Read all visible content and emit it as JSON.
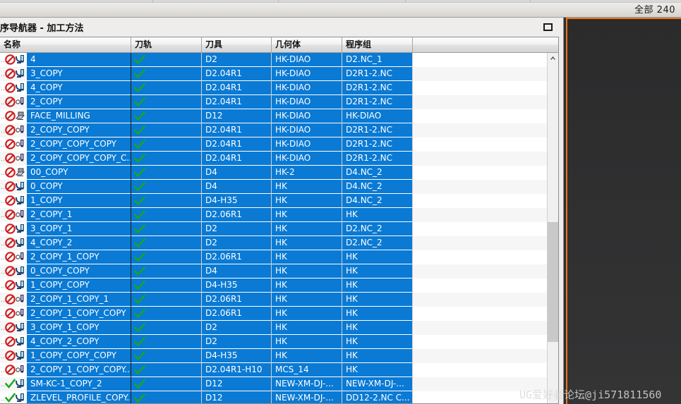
{
  "topbar": {
    "all_count_label": "全部 240"
  },
  "panel": {
    "title": "序导航器 - 加工方法",
    "restore_button_label": ""
  },
  "table": {
    "columns": [
      {
        "key": "name",
        "label": "名称"
      },
      {
        "key": "toolpath",
        "label": "刀轨"
      },
      {
        "key": "tool",
        "label": "刀具"
      },
      {
        "key": "geometry",
        "label": "几何体"
      },
      {
        "key": "program",
        "label": "程序组"
      },
      {
        "key": "extra",
        "label": ""
      }
    ],
    "rows": [
      {
        "status": "blocked",
        "type": "contour",
        "name": "4",
        "toolpath": "ok",
        "tool": "D2",
        "geometry": "HK-DIAO",
        "program": "D2.NC_1"
      },
      {
        "status": "blocked",
        "type": "contour",
        "name": "3_COPY",
        "toolpath": "ok",
        "tool": "D2.04R1",
        "geometry": "HK-DIAO",
        "program": "D2R1-2.NC"
      },
      {
        "status": "blocked",
        "type": "contour",
        "name": "4_COPY",
        "toolpath": "ok",
        "tool": "D2.04R1",
        "geometry": "HK-DIAO",
        "program": "D2R1-2.NC"
      },
      {
        "status": "blocked",
        "type": "drill",
        "name": "2_COPY",
        "toolpath": "ok",
        "tool": "D2.04R1",
        "geometry": "HK-DIAO",
        "program": "D2R1-2.NC"
      },
      {
        "status": "blocked",
        "type": "face",
        "name": "FACE_MILLING",
        "toolpath": "ok",
        "tool": "D12",
        "geometry": "HK-DIAO",
        "program": "HK-DIAO"
      },
      {
        "status": "blocked",
        "type": "drill",
        "name": "2_COPY_COPY",
        "toolpath": "ok",
        "tool": "D2.04R1",
        "geometry": "HK-DIAO",
        "program": "D2R1-2.NC"
      },
      {
        "status": "blocked",
        "type": "drill",
        "name": "2_COPY_COPY_COPY",
        "toolpath": "ok",
        "tool": "D2.04R1",
        "geometry": "HK-DIAO",
        "program": "D2R1-2.NC"
      },
      {
        "status": "blocked",
        "type": "drill",
        "name": "2_COPY_COPY_COPY_C...",
        "toolpath": "ok",
        "tool": "D2.04R1",
        "geometry": "HK-DIAO",
        "program": "D2R1-2.NC"
      },
      {
        "status": "blocked",
        "type": "face",
        "name": "00_COPY",
        "toolpath": "ok",
        "tool": "D4",
        "geometry": "HK-2",
        "program": "D4.NC_2"
      },
      {
        "status": "blocked",
        "type": "contour",
        "name": "0_COPY",
        "toolpath": "ok",
        "tool": "D4",
        "geometry": "HK",
        "program": "D4.NC_2"
      },
      {
        "status": "blocked",
        "type": "contour",
        "name": "1_COPY",
        "toolpath": "ok",
        "tool": "D4-H35",
        "geometry": "HK",
        "program": "D4.NC_2"
      },
      {
        "status": "blocked",
        "type": "drill",
        "name": "2_COPY_1",
        "toolpath": "ok",
        "tool": "D2.06R1",
        "geometry": "HK",
        "program": "HK"
      },
      {
        "status": "blocked",
        "type": "contour",
        "name": "3_COPY_1",
        "toolpath": "ok",
        "tool": "D2",
        "geometry": "HK",
        "program": "D2.NC_2"
      },
      {
        "status": "blocked",
        "type": "contour",
        "name": "4_COPY_2",
        "toolpath": "ok",
        "tool": "D2",
        "geometry": "HK",
        "program": "D2.NC_2"
      },
      {
        "status": "blocked",
        "type": "drill",
        "name": "2_COPY_1_COPY",
        "toolpath": "ok",
        "tool": "D2.06R1",
        "geometry": "HK",
        "program": "HK"
      },
      {
        "status": "blocked",
        "type": "contour",
        "name": "0_COPY_COPY",
        "toolpath": "ok",
        "tool": "D4",
        "geometry": "HK",
        "program": "HK"
      },
      {
        "status": "blocked",
        "type": "contour",
        "name": "1_COPY_COPY",
        "toolpath": "ok",
        "tool": "D4-H35",
        "geometry": "HK",
        "program": "HK"
      },
      {
        "status": "blocked",
        "type": "drill",
        "name": "2_COPY_1_COPY_1",
        "toolpath": "ok",
        "tool": "D2.06R1",
        "geometry": "HK",
        "program": "HK"
      },
      {
        "status": "blocked",
        "type": "drill",
        "name": "2_COPY_1_COPY_COPY",
        "toolpath": "ok",
        "tool": "D2.06R1",
        "geometry": "HK",
        "program": "HK"
      },
      {
        "status": "blocked",
        "type": "contour",
        "name": "3_COPY_1_COPY",
        "toolpath": "ok",
        "tool": "D2",
        "geometry": "HK",
        "program": "HK"
      },
      {
        "status": "blocked",
        "type": "contour",
        "name": "4_COPY_2_COPY",
        "toolpath": "ok",
        "tool": "D2",
        "geometry": "HK",
        "program": "HK"
      },
      {
        "status": "blocked",
        "type": "contour",
        "name": "1_COPY_COPY_COPY",
        "toolpath": "ok",
        "tool": "D4-H35",
        "geometry": "HK",
        "program": "HK"
      },
      {
        "status": "blocked",
        "type": "drill",
        "name": "2_COPY_1_COPY_COPY...",
        "toolpath": "ok",
        "tool": "D2.04R1-H10",
        "geometry": "MCS_14",
        "program": "HK"
      },
      {
        "status": "done",
        "type": "contour",
        "name": "SM-KC-1_COPY_2",
        "toolpath": "ok",
        "tool": "D12",
        "geometry": "NEW-XM-DJ-...",
        "program": "NEW-XM-DJ-..."
      },
      {
        "status": "done",
        "type": "contour",
        "name": "ZLEVEL_PROFILE_COPY...",
        "toolpath": "ok",
        "tool": "D12",
        "geometry": "NEW-XM-DJ-...",
        "program": "DD12-2.NC C..."
      }
    ]
  },
  "watermark": {
    "text": "UG爱好者论坛@ji571811560"
  },
  "colors": {
    "selection_blue": "#0a7ad4",
    "accent_orange": "#e8751a",
    "dark_viewport": "#2f2f30",
    "blocked_red": "#cf2020",
    "ok_green": "#1faa21"
  }
}
